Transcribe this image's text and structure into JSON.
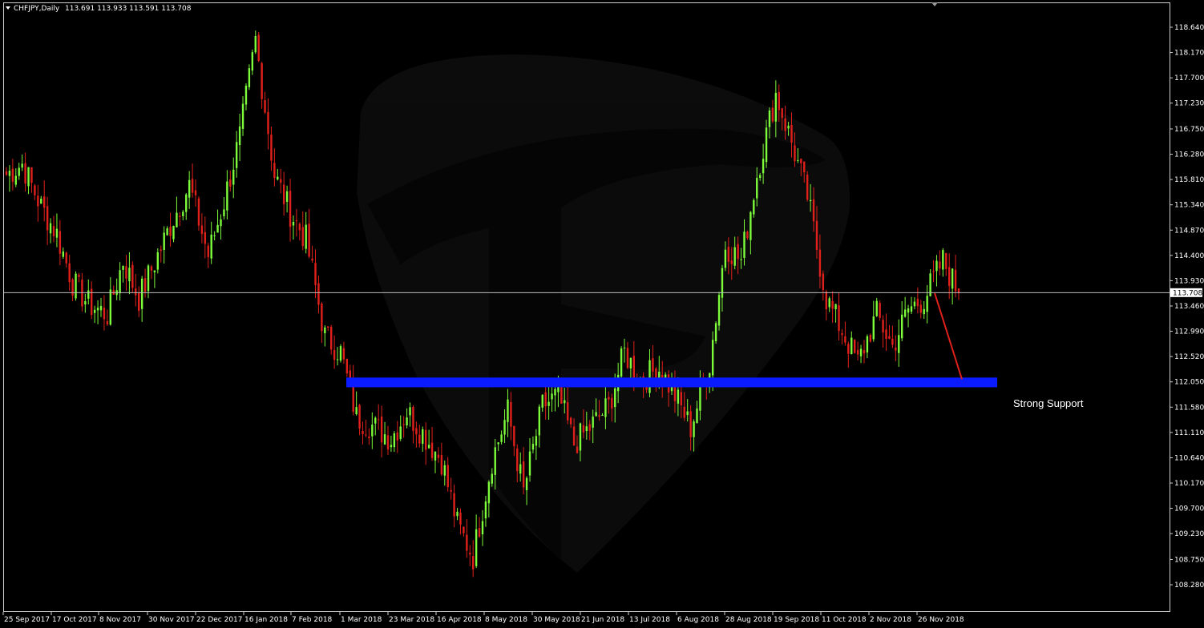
{
  "header": {
    "symbol": "CHFJPY,Daily",
    "ohlc": "113.691 113.933 113.591 113.708"
  },
  "current_price_label": "113.708",
  "annotation": "Strong Support",
  "colors": {
    "background": "#000000",
    "bull": "#7cfc3a",
    "bear": "#e0201a",
    "support_zone": "#0a1cff",
    "projection_line": "#e0201a",
    "grid_line": "#ffffff"
  },
  "chart_data": {
    "type": "candlestick",
    "timeframe": "Daily",
    "symbol": "CHFJPY",
    "x_tick_labels": [
      "25 Sep 2017",
      "17 Oct 2017",
      "8 Nov 2017",
      "30 Nov 2017",
      "22 Dec 2017",
      "16 Jan 2018",
      "7 Feb 2018",
      "1 Mar 2018",
      "23 Mar 2018",
      "16 Apr 2018",
      "8 May 2018",
      "30 May 2018",
      "21 Jun 2018",
      "13 Jul 2018",
      "6 Aug 2018",
      "28 Aug 2018",
      "19 Sep 2018",
      "11 Oct 2018",
      "2 Nov 2018",
      "26 Nov 2018"
    ],
    "y_tick_labels": [
      "118.640",
      "118.170",
      "117.700",
      "117.230",
      "116.750",
      "116.280",
      "115.810",
      "115.340",
      "114.870",
      "114.400",
      "113.930",
      "113.460",
      "112.990",
      "112.520",
      "112.050",
      "111.580",
      "111.110",
      "110.640",
      "110.170",
      "109.700",
      "109.230",
      "108.750",
      "108.280"
    ],
    "ylim": [
      108.15,
      118.9
    ],
    "current_price": 113.708,
    "support_zone": {
      "low": 111.95,
      "high": 112.13
    },
    "projection": {
      "from_price": 113.7,
      "to_price": 112.1
    },
    "key_points": [
      {
        "date": "25 Sep 2017",
        "close": 115.9
      },
      {
        "date": "3 Oct 2017",
        "close": 116.1
      },
      {
        "date": "17 Oct 2017",
        "close": 115.3
      },
      {
        "date": "25 Oct 2017",
        "close": 114.8
      },
      {
        "date": "8 Nov 2017",
        "close": 113.9
      },
      {
        "date": "16 Nov 2017",
        "close": 113.5
      },
      {
        "date": "24 Nov 2017",
        "close": 113.3
      },
      {
        "date": "30 Nov 2017",
        "close": 114.3
      },
      {
        "date": "8 Dec 2017",
        "close": 113.6
      },
      {
        "date": "15 Dec 2017",
        "close": 114.4
      },
      {
        "date": "22 Dec 2017",
        "close": 115.1
      },
      {
        "date": "2 Jan 2018",
        "close": 115.7
      },
      {
        "date": "9 Jan 2018",
        "close": 114.4
      },
      {
        "date": "16 Jan 2018",
        "close": 115.4
      },
      {
        "date": "24 Jan 2018",
        "close": 116.6
      },
      {
        "date": "29 Jan 2018",
        "close": 118.4
      },
      {
        "date": "7 Feb 2018",
        "close": 115.9
      },
      {
        "date": "14 Feb 2018",
        "close": 115.2
      },
      {
        "date": "21 Feb 2018",
        "close": 114.7
      },
      {
        "date": "1 Mar 2018",
        "close": 112.9
      },
      {
        "date": "8 Mar 2018",
        "close": 112.6
      },
      {
        "date": "15 Mar 2018",
        "close": 111.4
      },
      {
        "date": "23 Mar 2018",
        "close": 111.2
      },
      {
        "date": "30 Mar 2018",
        "close": 111.0
      },
      {
        "date": "9 Apr 2018",
        "close": 111.5
      },
      {
        "date": "16 Apr 2018",
        "close": 111.1
      },
      {
        "date": "24 Apr 2018",
        "close": 110.6
      },
      {
        "date": "3 May 2018",
        "close": 109.4
      },
      {
        "date": "8 May 2018",
        "close": 108.8
      },
      {
        "date": "17 May 2018",
        "close": 110.6
      },
      {
        "date": "23 May 2018",
        "close": 111.5
      },
      {
        "date": "30 May 2018",
        "close": 110.0
      },
      {
        "date": "6 Jun 2018",
        "close": 111.6
      },
      {
        "date": "13 Jun 2018",
        "close": 111.8
      },
      {
        "date": "21 Jun 2018",
        "close": 110.9
      },
      {
        "date": "28 Jun 2018",
        "close": 111.2
      },
      {
        "date": "5 Jul 2018",
        "close": 111.6
      },
      {
        "date": "13 Jul 2018",
        "close": 112.6
      },
      {
        "date": "20 Jul 2018",
        "close": 112.1
      },
      {
        "date": "27 Jul 2018",
        "close": 112.3
      },
      {
        "date": "6 Aug 2018",
        "close": 111.8
      },
      {
        "date": "13 Aug 2018",
        "close": 111.2
      },
      {
        "date": "20 Aug 2018",
        "close": 112.4
      },
      {
        "date": "28 Aug 2018",
        "close": 114.6
      },
      {
        "date": "4 Sep 2018",
        "close": 114.3
      },
      {
        "date": "11 Sep 2018",
        "close": 115.9
      },
      {
        "date": "19 Sep 2018",
        "close": 117.4
      },
      {
        "date": "26 Sep 2018",
        "close": 116.5
      },
      {
        "date": "3 Oct 2018",
        "close": 115.5
      },
      {
        "date": "11 Oct 2018",
        "close": 113.6
      },
      {
        "date": "18 Oct 2018",
        "close": 113.0
      },
      {
        "date": "25 Oct 2018",
        "close": 112.4
      },
      {
        "date": "2 Nov 2018",
        "close": 113.3
      },
      {
        "date": "9 Nov 2018",
        "close": 112.7
      },
      {
        "date": "16 Nov 2018",
        "close": 113.4
      },
      {
        "date": "22 Nov 2018",
        "close": 113.6
      },
      {
        "date": "26 Nov 2018",
        "close": 114.3
      },
      {
        "date": "29 Nov 2018",
        "close": 113.7
      }
    ]
  }
}
